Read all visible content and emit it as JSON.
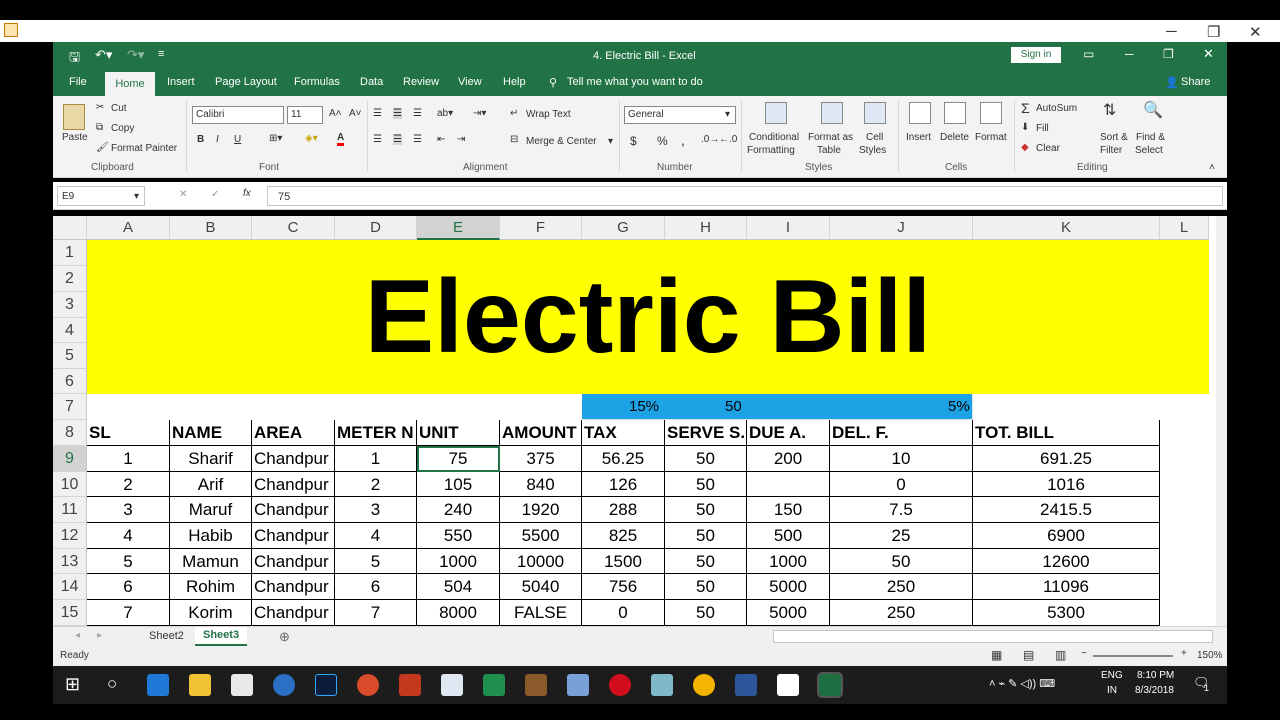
{
  "window": {
    "app_title": "4. Electric Bill - Excel",
    "sign_in": "Sign in"
  },
  "tabs": [
    "File",
    "Home",
    "Insert",
    "Page Layout",
    "Formulas",
    "Data",
    "Review",
    "View",
    "Help"
  ],
  "tell_me": "Tell me what you want to do",
  "share": "Share",
  "ribbon": {
    "clipboard": {
      "paste": "Paste",
      "cut": "Cut",
      "copy": "Copy",
      "format_painter": "Format Painter",
      "label": "Clipboard"
    },
    "font": {
      "name": "Calibri",
      "size": "11",
      "label": "Font",
      "bold": "B",
      "italic": "I",
      "underline": "U"
    },
    "alignment": {
      "wrap": "Wrap Text",
      "merge": "Merge & Center",
      "label": "Alignment"
    },
    "number": {
      "format": "General",
      "currency": "$",
      "percent": "%",
      "comma": ",",
      "label": "Number"
    },
    "styles": {
      "cond1": "Conditional",
      "cond2": "Formatting",
      "fmt1": "Format as",
      "fmt2": "Table",
      "cell1": "Cell",
      "cell2": "Styles",
      "label": "Styles"
    },
    "cells": {
      "insert": "Insert",
      "delete": "Delete",
      "format": "Format",
      "label": "Cells"
    },
    "editing": {
      "autosum": "AutoSum",
      "fill": "Fill",
      "clear": "Clear",
      "sort1": "Sort &",
      "sort2": "Filter",
      "find1": "Find &",
      "find2": "Select",
      "label": "Editing"
    }
  },
  "formula_bar": {
    "name_box": "E9",
    "fx": "fx",
    "value": "75"
  },
  "columns": [
    "A",
    "B",
    "C",
    "D",
    "E",
    "F",
    "G",
    "H",
    "I",
    "J",
    "K",
    "L"
  ],
  "rows": [
    "1",
    "2",
    "3",
    "4",
    "5",
    "6",
    "7",
    "8",
    "9",
    "10",
    "11",
    "12",
    "13",
    "14",
    "15"
  ],
  "title": "Electric Bill",
  "rates": {
    "tax": "15%",
    "serve": "50",
    "del": "5%"
  },
  "headers": [
    "SL",
    "NAME",
    "AREA",
    "METER N",
    "UNIT",
    "AMOUNT",
    "TAX",
    "SERVE S.",
    "DUE A.",
    "DEL. F.",
    "TOT. BILL"
  ],
  "data": [
    [
      "1",
      "Sharif",
      "Chandpur",
      "1",
      "75",
      "375",
      "56.25",
      "50",
      "200",
      "10",
      "691.25"
    ],
    [
      "2",
      "Arif",
      "Chandpur",
      "2",
      "105",
      "840",
      "126",
      "50",
      "",
      "0",
      "1016"
    ],
    [
      "3",
      "Maruf",
      "Chandpur",
      "3",
      "240",
      "1920",
      "288",
      "50",
      "150",
      "7.5",
      "2415.5"
    ],
    [
      "4",
      "Habib",
      "Chandpur",
      "4",
      "550",
      "5500",
      "825",
      "50",
      "500",
      "25",
      "6900"
    ],
    [
      "5",
      "Mamun",
      "Chandpur",
      "5",
      "1000",
      "10000",
      "1500",
      "50",
      "1000",
      "50",
      "12600"
    ],
    [
      "6",
      "Rohim",
      "Chandpur",
      "6",
      "504",
      "5040",
      "756",
      "50",
      "5000",
      "250",
      "11096"
    ],
    [
      "7",
      "Korim",
      "Chandpur",
      "7",
      "8000",
      "FALSE",
      "0",
      "50",
      "5000",
      "250",
      "5300"
    ]
  ],
  "sheets": [
    "Sheet2",
    "Sheet3"
  ],
  "status": {
    "ready": "Ready",
    "zoom": "150%"
  },
  "tray": {
    "lang1": "ENG",
    "lang2": "IN",
    "time": "8:10 PM",
    "date": "8/3/2018",
    "notif": "1"
  }
}
